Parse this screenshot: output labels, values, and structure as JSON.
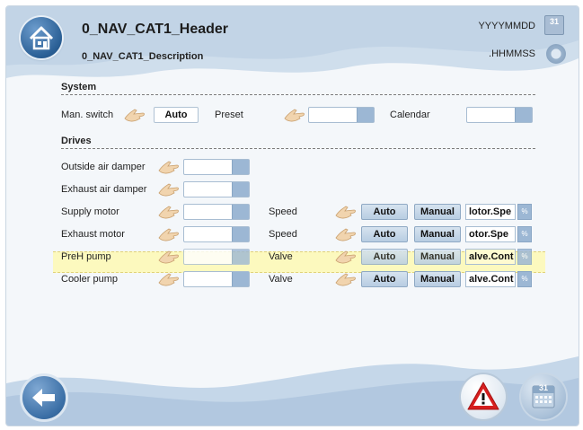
{
  "header": {
    "title": "0_NAV_CAT1_Header",
    "description": "0_NAV_CAT1_Description",
    "date_placeholder": "YYYYMMDD",
    "time_placeholder": ".HHMMSS",
    "calendar_day": "31"
  },
  "system": {
    "section_label": "System",
    "man_switch_label": "Man. switch",
    "auto_label": "Auto",
    "preset_label": "Preset",
    "calendar_label": "Calendar"
  },
  "drives": {
    "section_label": "Drives",
    "rows": [
      {
        "label": "Outside air damper"
      },
      {
        "label": "Exhaust air damper"
      },
      {
        "label": "Supply motor",
        "param": "Speed",
        "auto": "Auto",
        "manual": "Manual",
        "value": "lotor.Spe",
        "unit": "%"
      },
      {
        "label": "Exhaust motor",
        "param": "Speed",
        "auto": "Auto",
        "manual": "Manual",
        "value": "otor.Spe",
        "unit": "%"
      },
      {
        "label": "PreH pump",
        "param": "Valve",
        "auto": "Auto",
        "manual": "Manual",
        "value": "alve.Cont",
        "unit": "%"
      },
      {
        "label": "Cooler pump",
        "param": "Valve",
        "auto": "Auto",
        "manual": "Manual",
        "value": "alve.Cont",
        "unit": "%"
      }
    ]
  },
  "footer": {
    "calendar_day": "31"
  },
  "colors": {
    "accent": "#2a5f95",
    "highlight": "#fffaaa",
    "alarm": "#d61f1f"
  }
}
